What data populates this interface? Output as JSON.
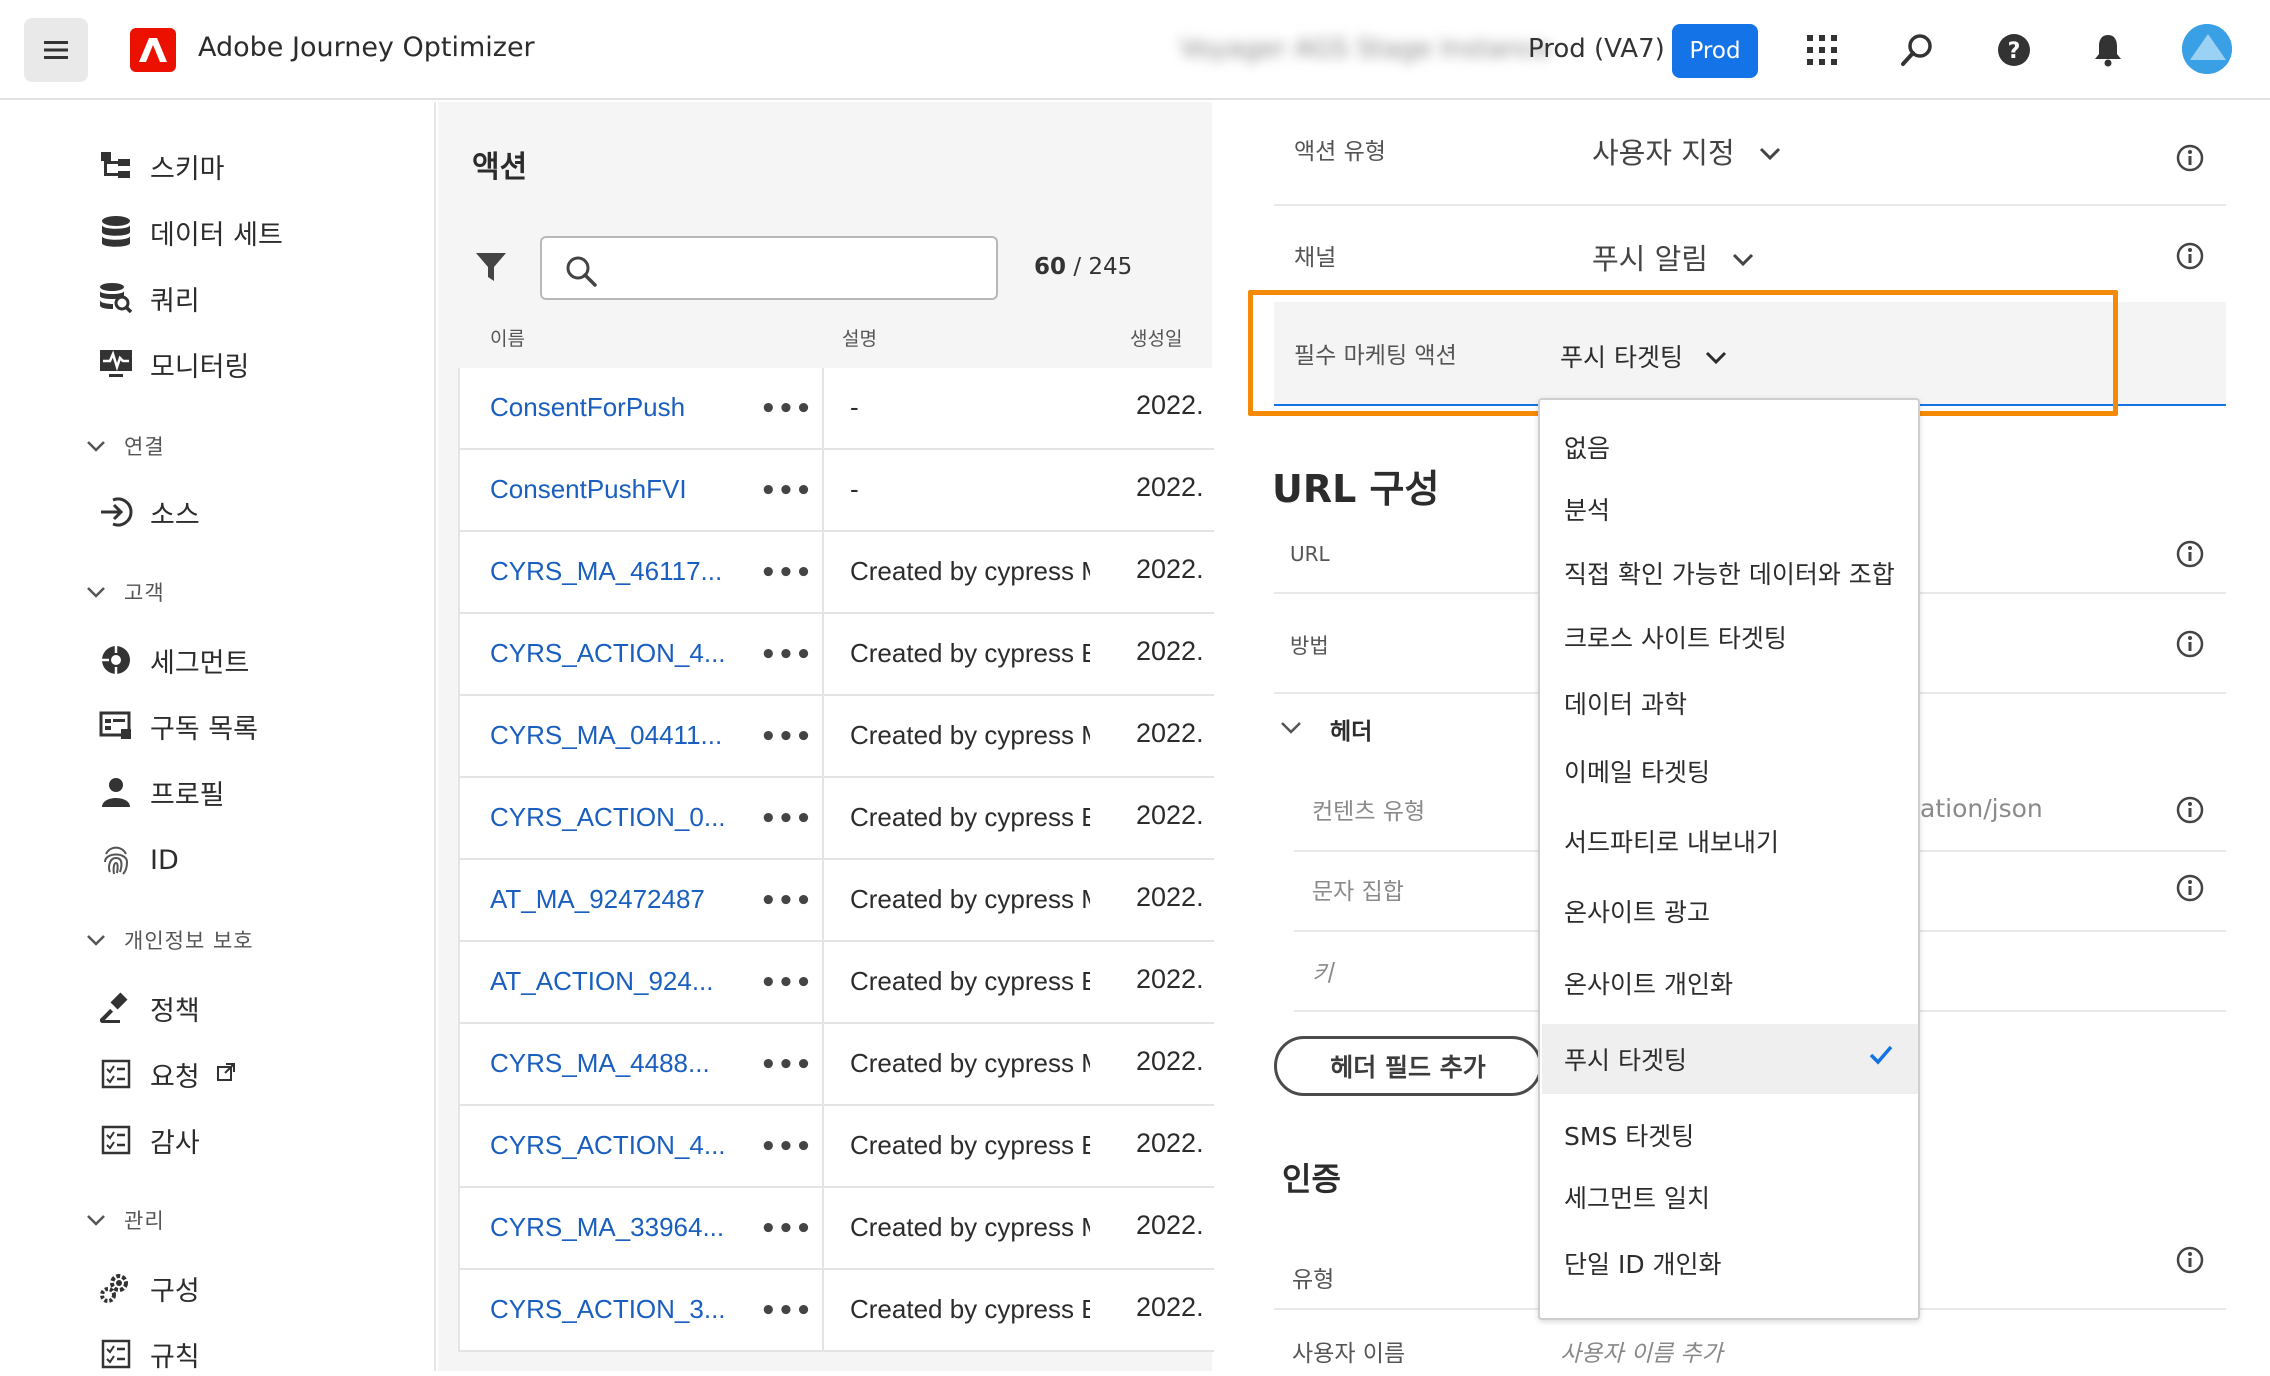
{
  "header": {
    "app_title": "Adobe Journey Optimizer",
    "org_name": "Voyager AGS Stage Instance",
    "sandbox_label": "Prod (VA7)",
    "prod_badge": "Prod"
  },
  "sidebar": {
    "items": [
      {
        "label": "스키마",
        "icon": "schema-icon"
      },
      {
        "label": "데이터 세트",
        "icon": "datasets-icon"
      },
      {
        "label": "쿼리",
        "icon": "queries-icon"
      },
      {
        "label": "모니터링",
        "icon": "monitoring-icon"
      }
    ],
    "section_connections": "연결",
    "sources": "소스",
    "section_customer": "고객",
    "segments": "세그먼트",
    "subscriptions": "구독 목록",
    "profiles": "프로필",
    "identities": "ID",
    "section_privacy": "개인정보 보호",
    "policies": "정책",
    "requests": "요청",
    "audits": "감사",
    "section_admin": "관리",
    "configurations": "구성",
    "rules": "규칙"
  },
  "list": {
    "title": "액션",
    "search_placeholder": "",
    "count_shown": "60",
    "count_sep": "/",
    "count_total": "245",
    "col_name": "이름",
    "col_desc": "설명",
    "col_created": "생성일",
    "rows": [
      {
        "name": "ConsentForPush",
        "desc": "-",
        "date": "2022."
      },
      {
        "name": "ConsentPushFVI",
        "desc": "-",
        "date": "2022."
      },
      {
        "name": "CYRS_MA_46117...",
        "desc": "Created by cypress M",
        "date": "2022."
      },
      {
        "name": "CYRS_ACTION_4...",
        "desc": "Created by cypress E",
        "date": "2022."
      },
      {
        "name": "CYRS_MA_04411...",
        "desc": "Created by cypress M",
        "date": "2022."
      },
      {
        "name": "CYRS_ACTION_0...",
        "desc": "Created by cypress E",
        "date": "2022."
      },
      {
        "name": "AT_MA_92472487",
        "desc": "Created by cypress M",
        "date": "2022."
      },
      {
        "name": "AT_ACTION_924...",
        "desc": "Created by cypress E",
        "date": "2022."
      },
      {
        "name": "CYRS_MA_4488...",
        "desc": "Created by cypress M",
        "date": "2022."
      },
      {
        "name": "CYRS_ACTION_4...",
        "desc": "Created by cypress E",
        "date": "2022."
      },
      {
        "name": "CYRS_MA_33964...",
        "desc": "Created by cypress M",
        "date": "2022."
      },
      {
        "name": "CYRS_ACTION_3...",
        "desc": "Created by cypress E",
        "date": "2022."
      }
    ],
    "more_label": "•••"
  },
  "config": {
    "action_type_label": "액션 유형",
    "action_type_value": "사용자 지정",
    "channel_label": "채널",
    "channel_value": "푸시 알림",
    "marketing_label": "필수 마케팅 액션",
    "marketing_value": "푸시 타겟팅",
    "url_section": "URL 구성",
    "url_label": "URL",
    "method_label": "방법",
    "headers_label": "헤더",
    "content_type_label": "컨텐츠 유형",
    "content_type_value": "ation/json",
    "charset_label": "문자 집합",
    "key_label": "키",
    "add_header_button": "헤더 필드 추가",
    "auth_section": "인증",
    "type_label": "유형",
    "username_label": "사용자 이름",
    "username_placeholder": "사용자 이름 추가"
  },
  "dropdown": {
    "options": [
      "없음",
      "분석",
      "직접 확인 가능한 데이터와 조합",
      "크로스 사이트 타겟팅",
      "데이터 과학",
      "이메일 타겟팅",
      "서드파티로 내보내기",
      "온사이트 광고",
      "온사이트 개인화",
      "푸시 타겟팅",
      "SMS 타겟팅",
      "세그먼트 일치",
      "단일 ID 개인화"
    ],
    "selected": "푸시 타겟팅"
  },
  "colors": {
    "accent": "#1473e6",
    "link": "#1a5fc0",
    "highlight": "#f58a07",
    "adobe_red": "#eb1000"
  }
}
